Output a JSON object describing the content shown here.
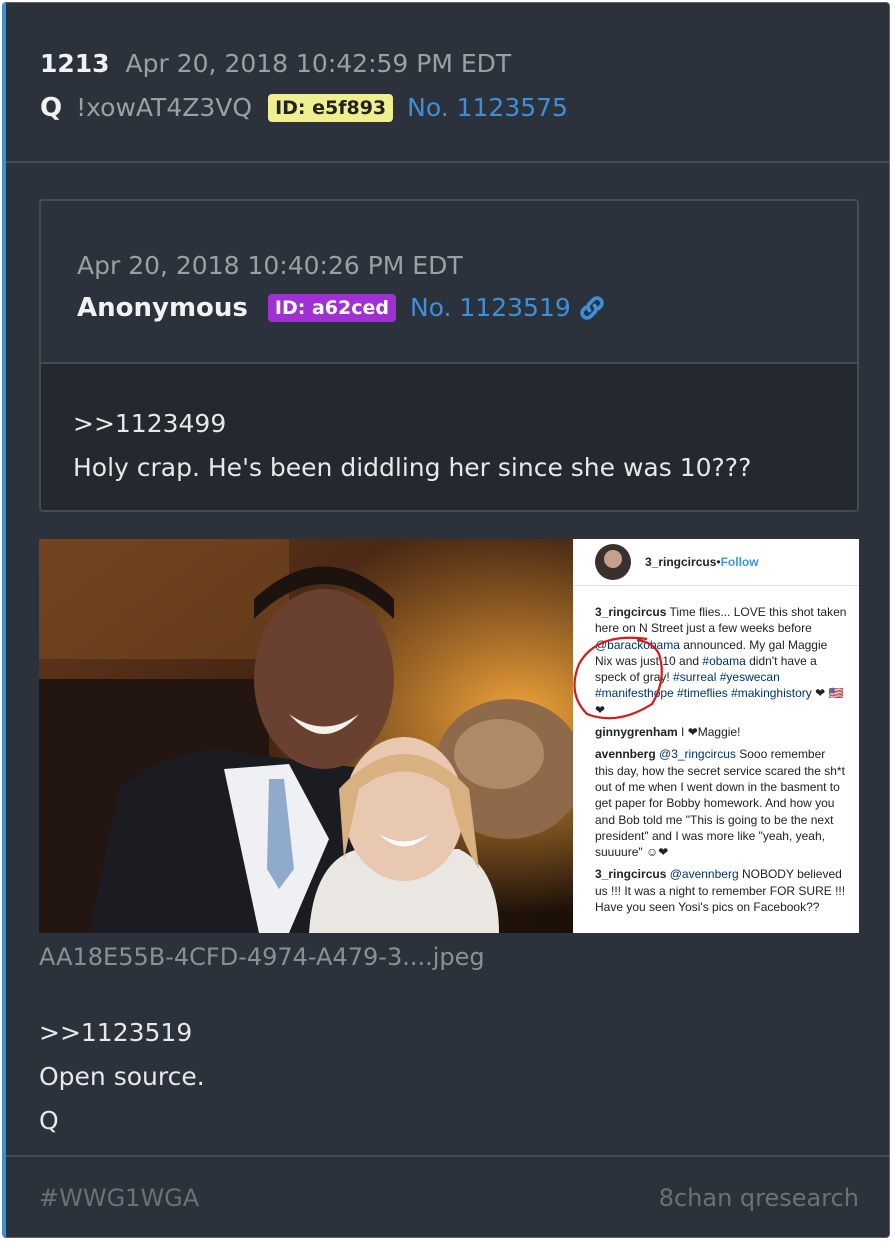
{
  "post": {
    "number": "1213",
    "date": "Apr 20, 2018 10:42:59 PM EDT",
    "author": "Q",
    "trip": "!xowAT4Z3VQ",
    "id_badge": "ID: e5f893",
    "post_link": "No. 1123575"
  },
  "quoted": {
    "date": "Apr 20, 2018 10:40:26 PM EDT",
    "author": "Anonymous",
    "id_badge": "ID: a62ced",
    "post_link": "No. 1123519",
    "line1": ">>1123499",
    "line2": "Holy crap. He's been diddling her since she was 10???"
  },
  "image": {
    "filename": "AA18E55B-4CFD-4974-A479-3....jpeg",
    "insta": {
      "username": "3_ringcircus",
      "separator": " • ",
      "follow": "Follow",
      "c1_user": "3_ringcircus",
      "c1_a": " Time flies... LOVE this shot taken here on N Street just a few weeks before ",
      "c1_mention": "@barackobama",
      "c1_b": " announced. My gal Maggie Nix was just 10 and ",
      "c1_tag1": "#obama",
      "c1_c": " didn't have a speck of gray! ",
      "c1_tags": "#surreal #yeswecan #manifesthope #timeflies #makinghistory",
      "c1_end": " ❤ 🇺🇸❤",
      "c2_user": "ginnygrenham",
      "c2_text": " I ❤Maggie!",
      "c3_user": "avennberg",
      "c3_mention": "@3_ringcircus",
      "c3_text": " Sooo remember this day, how the secret service scared the sh*t out of me when I went down in the basment to get paper for Bobby homework. And how you and Bob told me \"This is going to be the next president\" and I was more like \"yeah, yeah, suuuure\" ☺❤",
      "c4_user": "3_ringcircus",
      "c4_mention": "@avennberg",
      "c4_text": " NOBODY believed us !!! It was a night to remember FOR SURE !!! Have you seen Yosi's pics on Facebook??"
    }
  },
  "body_lines": [
    ">>1123519",
    "Open source.",
    "Q"
  ],
  "footer": {
    "hashtag": "#WWG1WGA",
    "source": "8chan qresearch"
  },
  "colors": {
    "accent": "#3f8fd8",
    "id_yellow": "#efef8f",
    "id_purple": "#a02fd4",
    "annotation_red": "#d41a1a"
  }
}
